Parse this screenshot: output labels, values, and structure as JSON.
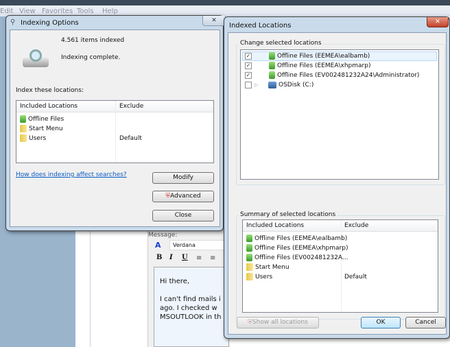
{
  "browser": {
    "menu": [
      "Edit",
      "View",
      "Favorites",
      "Tools",
      "Help"
    ]
  },
  "background_editor": {
    "label": "Message:",
    "font": "Verdana",
    "format_buttons": [
      "B",
      "I",
      "U"
    ],
    "text_lines": [
      "Hi there,",
      "I can't find mails i",
      "ago. I checked w",
      "MSOUTLOOK in th"
    ]
  },
  "indexing_options": {
    "title": "Indexing Options",
    "items_indexed": "4.561 items indexed",
    "status": "Indexing complete.",
    "locations_label": "Index these locations:",
    "columns": [
      "Included Locations",
      "Exclude"
    ],
    "rows": [
      {
        "name": "Offline Files",
        "exclude": "",
        "icon": "offline-files-icon"
      },
      {
        "name": "Start Menu",
        "exclude": "",
        "icon": "folder-icon"
      },
      {
        "name": "Users",
        "exclude": "Default",
        "icon": "folder-icon"
      }
    ],
    "help_link": "How does indexing affect searches?",
    "buttons": {
      "modify": "Modify",
      "advanced": "Advanced",
      "close": "Close"
    },
    "close_glyph": "✕"
  },
  "indexed_locations": {
    "title": "Indexed Locations",
    "close_glyph": "✕",
    "change_label": "Change selected locations",
    "tree": [
      {
        "name": "Offline Files (EEMEA\\ealbamb)",
        "checked": true,
        "icon": "offline-files-icon",
        "selected": true
      },
      {
        "name": "Offline Files (EEMEA\\xhpmarp)",
        "checked": true,
        "icon": "offline-files-icon"
      },
      {
        "name": "Offline Files (EV002481232A24\\Administrator)",
        "checked": true,
        "icon": "offline-files-icon"
      },
      {
        "name": "OSDisk (C:)",
        "checked": false,
        "icon": "disk-icon",
        "expandable": true
      }
    ],
    "summary_label": "Summary of selected locations",
    "columns": [
      "Included Locations",
      "Exclude"
    ],
    "summary_rows": [
      {
        "name": "Offline Files (EEMEA\\ealbamb)",
        "exclude": "",
        "icon": "offline-files-icon"
      },
      {
        "name": "Offline Files (EEMEA\\xhpmarp)",
        "exclude": "",
        "icon": "offline-files-icon"
      },
      {
        "name": "Offline Files (EV002481232A...",
        "exclude": "",
        "icon": "offline-files-icon"
      },
      {
        "name": "Start Menu",
        "exclude": "",
        "icon": "folder-icon"
      },
      {
        "name": "Users",
        "exclude": "Default",
        "icon": "folder-icon"
      }
    ],
    "buttons": {
      "show_all": "Show all locations",
      "ok": "OK",
      "cancel": "Cancel"
    }
  }
}
